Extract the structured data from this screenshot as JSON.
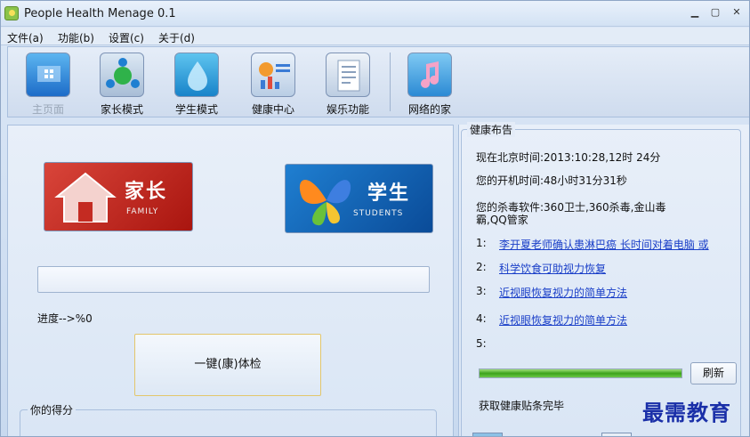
{
  "window": {
    "title": "People Health Menage 0.1",
    "controls": [
      "▁",
      "▢",
      "✕"
    ]
  },
  "menu": [
    "文件(a)",
    "功能(b)",
    "设置(c)",
    "关于(d)"
  ],
  "toolbar": {
    "buttons": [
      {
        "label": "主页面",
        "icon": "monitor-icon",
        "disabled": true
      },
      {
        "label": "家长模式",
        "icon": "network-icon",
        "disabled": false
      },
      {
        "label": "学生模式",
        "icon": "drop-icon",
        "disabled": false
      },
      {
        "label": "健康中心",
        "icon": "dashboard-icon",
        "disabled": false
      },
      {
        "label": "娱乐功能",
        "icon": "document-icon",
        "disabled": false
      },
      {
        "label": "网络的家",
        "icon": "music-icon",
        "disabled": false
      }
    ]
  },
  "left": {
    "parent_banner": {
      "main": "家长",
      "sub": "FAMILY"
    },
    "student_banner": {
      "main": "学生",
      "sub": "STUDENTS"
    },
    "progress_label": "进度-->%0",
    "check_button": "一键(康)体检",
    "score_title": "你的得分"
  },
  "right": {
    "group_title": "健康布告",
    "beijing_time": "现在北京时间:2013:10:28,12时 24分",
    "uptime": "您的开机时间:48小时31分31秒",
    "antivirus": "您的杀毒软件:360卫士,360杀毒,金山毒霸,QQ管家",
    "news": [
      {
        "num": "1:",
        "text": "李开夏老师确认患淋巴癌 长时间对着电脑 或"
      },
      {
        "num": "2:",
        "text": "科学饮食可助视力恢复"
      },
      {
        "num": "3:",
        "text": "近视眼恢复视力的简单方法"
      },
      {
        "num": "4:",
        "text": "近视眼恢复视力的简单方法"
      },
      {
        "num": "5:",
        "text": ""
      }
    ],
    "progress": 1.0,
    "refresh_label": "刷新",
    "done_text": "获取健康贴条完毕"
  },
  "watermark": "最需教育",
  "colors": {
    "link": "#1a3fc8",
    "parent_red": "#c42b22",
    "student_blue": "#1565c0",
    "progress_green": "#3da31c"
  }
}
